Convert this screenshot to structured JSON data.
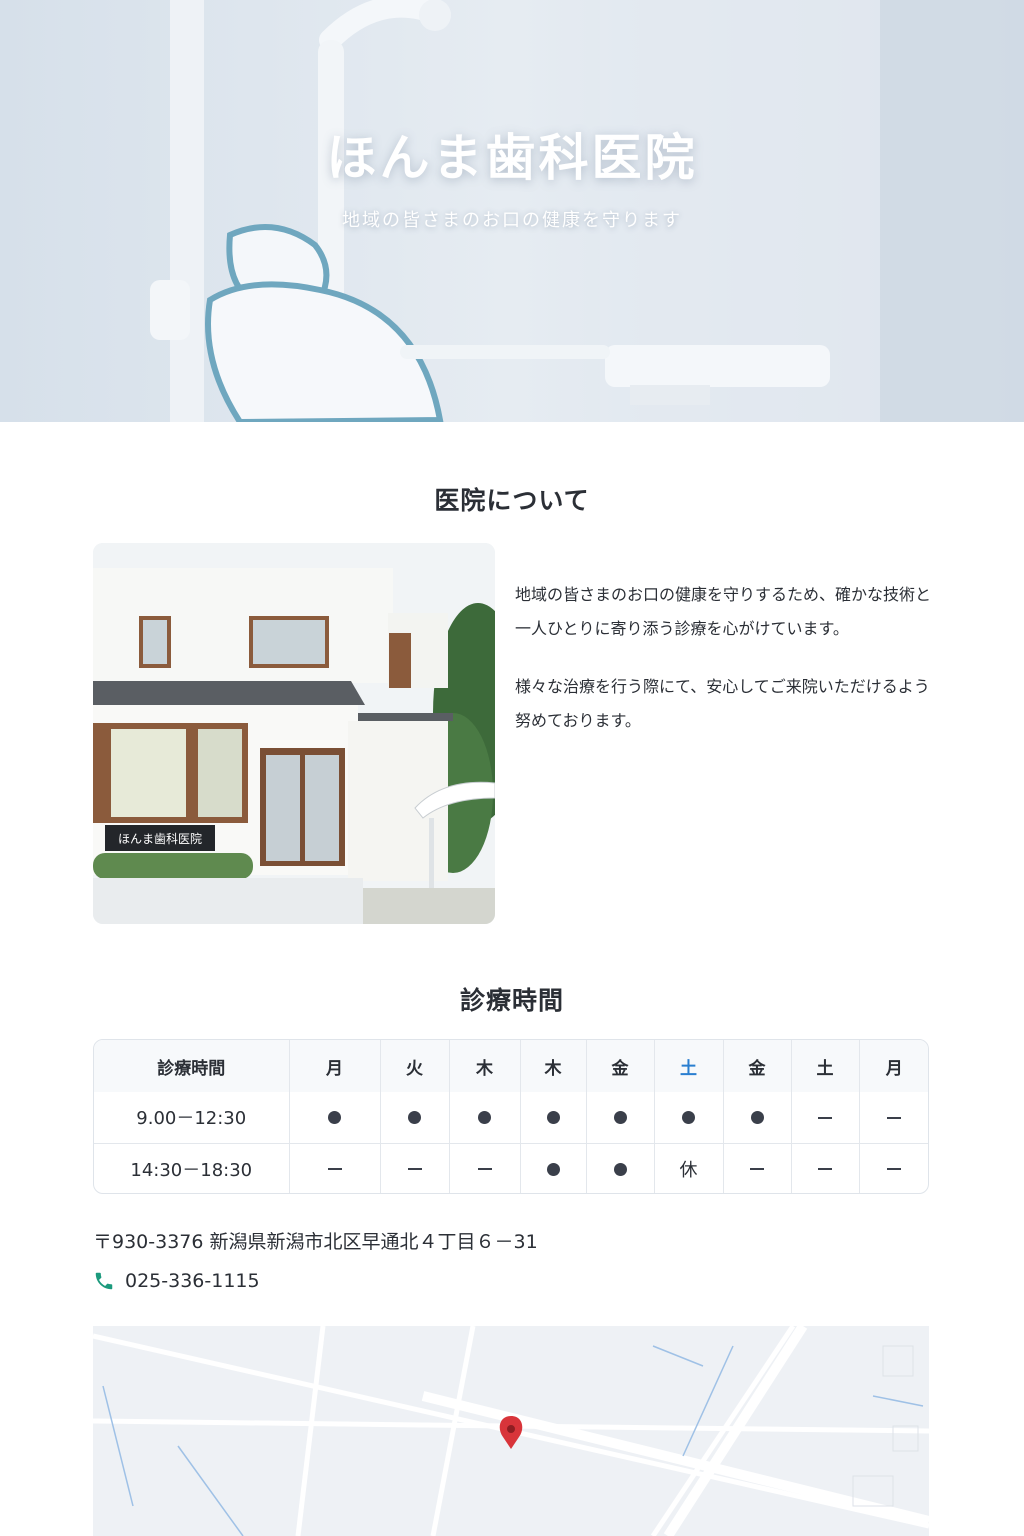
{
  "hero": {
    "title": "ほんま歯科医院",
    "subtitle": "地域の皆さまのお口の健康を守ります"
  },
  "about": {
    "title": "医院について",
    "paragraphs": [
      "地域の皆さまのお口の健康を守りするため、確かな技術と一人ひとりに寄り添う診療を心がけています。",
      "様々な治療を行う際にて、安心してご来院いただけるよう努めております。"
    ],
    "photo_sign": "ほんま歯科医院"
  },
  "hours": {
    "title": "診療時間",
    "header_label": "診療時間",
    "days": [
      "月",
      "火",
      "木",
      "木",
      "金",
      "土",
      "金",
      "土",
      "月"
    ],
    "rows": [
      {
        "time": "9.00－12:30",
        "cells": [
          "dot",
          "dot",
          "dot",
          "dot",
          "dot",
          "dot",
          "dot",
          "dash",
          "dash"
        ]
      },
      {
        "time": "14:30－18:30",
        "cells": [
          "dash",
          "dash",
          "dash",
          "dot",
          "dot",
          "休",
          "dash",
          "dash",
          "dash"
        ]
      }
    ]
  },
  "contact": {
    "address": "〒930-3376 新潟県新潟市北区早通北４丁目６－31",
    "phone": "025-336-1115"
  },
  "colors": {
    "accent_blue": "#2a7fd0",
    "phone_green": "#1c9a7d",
    "map_pin": "#d8343a"
  }
}
